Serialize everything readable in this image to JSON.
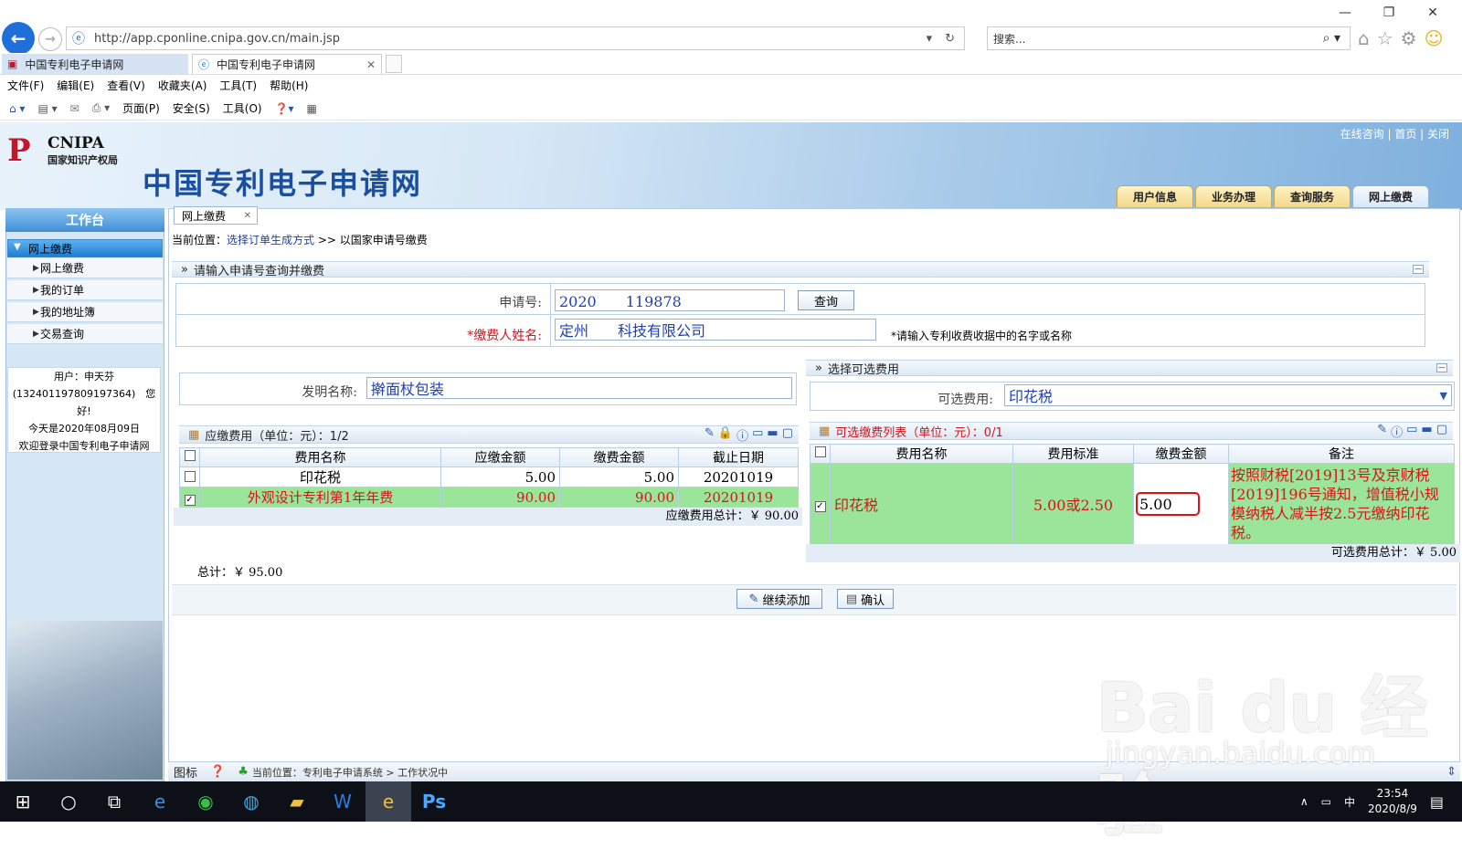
{
  "browser": {
    "url": "http://app.cponline.cnipa.gov.cn/main.jsp",
    "search_placeholder": "搜索...",
    "tabs": [
      "中国专利电子申请网",
      "中国专利电子申请网"
    ],
    "menu": [
      "文件(F)",
      "编辑(E)",
      "查看(V)",
      "收藏夹(A)",
      "工具(T)",
      "帮助(H)"
    ],
    "commands": [
      "页面(P)",
      "安全(S)",
      "工具(O)"
    ]
  },
  "banner": {
    "logo_en": "CNIPA",
    "logo_cn": "国家知识产权局",
    "site_title": "中国专利电子申请网",
    "top_links": "在线咨询 | 首页 | 关闭",
    "main_tabs": [
      "用户信息",
      "业务办理",
      "查询服务",
      "网上缴费"
    ]
  },
  "sidebar": {
    "header": "工作台",
    "group": "网上缴费",
    "items": [
      "网上缴费",
      "我的订单",
      "我的地址簿",
      "交易查询"
    ],
    "user_line1": "用户：申天芬",
    "user_line2": "(132401197809197364)　您好!",
    "user_line3": "今天是2020年08月09日",
    "user_line4": "欢迎登录中国专利电子申请网"
  },
  "content": {
    "tab_label": "网上缴费",
    "crumb_prefix": "当前位置：",
    "crumb_link": "选择订单生成方式",
    "crumb_sep": ">>",
    "crumb_current": "以国家申请号缴费",
    "query_section": "请输入申请号查询并缴费",
    "app_no_label": "申请号:",
    "app_no_value": "2020　　119878",
    "query_button": "查询",
    "payer_label": "*缴费人姓名:",
    "payer_value": "定州　　科技有限公司",
    "payer_hint": "*请输入专利收费收据中的名字或名称",
    "invention_label": "发明名称:",
    "invention_value": "擀面杖包装",
    "optional_section": "选择可选费用",
    "optional_label": "可选费用:",
    "optional_value": "印花税",
    "due_title": "应缴费用（单位：元）：1/2",
    "due_headers": [
      "费用名称",
      "应缴金额",
      "缴费金额",
      "截止日期"
    ],
    "due_rows": [
      {
        "name": "印花税",
        "due": "5.00",
        "pay": "5.00",
        "date": "20201019",
        "checked": false
      },
      {
        "name": "外观设计专利第1年年费",
        "due": "90.00",
        "pay": "90.00",
        "date": "20201019",
        "checked": true
      }
    ],
    "due_total": "应缴费用总计：￥ 90.00",
    "opt_title": "可选缴费列表（单位：元）：0/1",
    "opt_headers": [
      "费用名称",
      "费用标准",
      "缴费金额",
      "备注"
    ],
    "opt_row": {
      "name": "印花税",
      "standard": "5.00或2.50",
      "pay": "5.00",
      "note": "按照财税[2019]13号及京财税[2019]196号通知，增值税小规模纳税人减半按2.5元缴纳印花税。"
    },
    "opt_total": "可选费用总计：￥ 5.00",
    "grand_total": "总计：￥ 95.00",
    "add_button": "继续添加",
    "confirm_button": "确认",
    "status_label": "图标",
    "status_text": "当前位置：专利电子申请系统 > 工作状况中"
  },
  "watermark": {
    "line1": "Bai du 经验",
    "line2": "jingyan.baidu.com"
  },
  "taskbar": {
    "time": "23:54",
    "date": "2020/8/9",
    "ime": "中"
  }
}
